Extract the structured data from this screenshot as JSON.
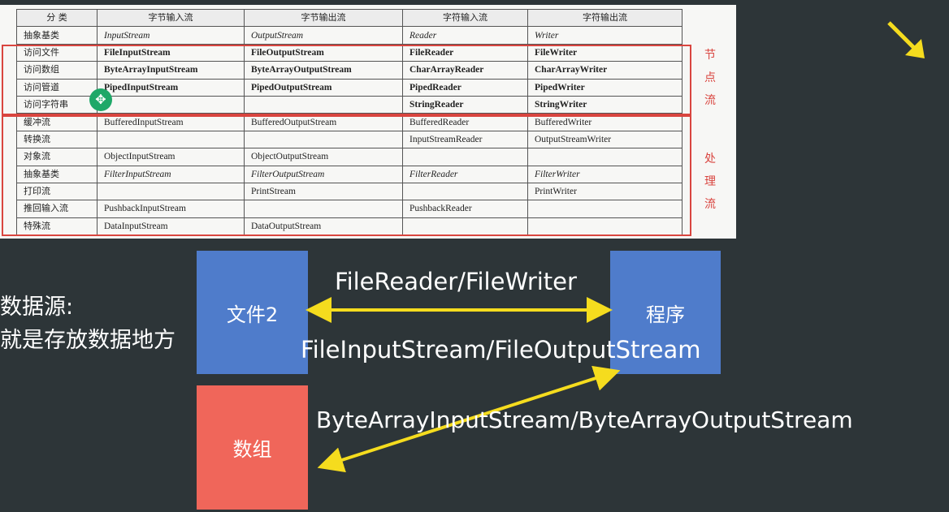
{
  "table": {
    "headers": [
      "分 类",
      "字节输入流",
      "字节输出流",
      "字符输入流",
      "字符输出流"
    ],
    "rows": [
      {
        "cat": "抽象基类",
        "cells": [
          "InputStream",
          "OutputStream",
          "Reader",
          "Writer"
        ]
      },
      {
        "cat": "访问文件",
        "cells": [
          "FileInputStream",
          "FileOutputStream",
          "FileReader",
          "FileWriter"
        ]
      },
      {
        "cat": "访问数组",
        "cells": [
          "ByteArrayInputStream",
          "ByteArrayOutputStream",
          "CharArrayReader",
          "CharArrayWriter"
        ]
      },
      {
        "cat": "访问管道",
        "cells": [
          "PipedInputStream",
          "PipedOutputStream",
          "PipedReader",
          "PipedWriter"
        ]
      },
      {
        "cat": "访问字符串",
        "cells": [
          "",
          "",
          "StringReader",
          "StringWriter"
        ]
      },
      {
        "cat": "缓冲流",
        "cells": [
          "BufferedInputStream",
          "BufferedOutputStream",
          "BufferedReader",
          "BufferedWriter"
        ]
      },
      {
        "cat": "转换流",
        "cells": [
          "",
          "",
          "InputStreamReader",
          "OutputStreamWriter"
        ]
      },
      {
        "cat": "对象流",
        "cells": [
          "ObjectInputStream",
          "ObjectOutputStream",
          "",
          ""
        ]
      },
      {
        "cat": "抽象基类",
        "cells": [
          "FilterInputStream",
          "FilterOutputStream",
          "FilterReader",
          "FilterWriter"
        ]
      },
      {
        "cat": "打印流",
        "cells": [
          "",
          "PrintStream",
          "",
          "PrintWriter"
        ]
      },
      {
        "cat": "推回输入流",
        "cells": [
          "PushbackInputStream",
          "",
          "PushbackReader",
          ""
        ]
      },
      {
        "cat": "特殊流",
        "cells": [
          "DataInputStream",
          "DataOutputStream",
          "",
          ""
        ]
      }
    ],
    "node_label": [
      "节",
      "点",
      "流"
    ],
    "process_label": [
      "处",
      "理",
      "流"
    ]
  },
  "diagram": {
    "file_box": "文件2",
    "program_box": "程序",
    "array_box": "数组",
    "reader_label": "FileReader/FileWriter",
    "filestream_label": "FileInputStream/FileOutputStream",
    "bytestream_label": "ByteArrayInputStream/ByteArrayOutputStream",
    "source_title": "数据源:",
    "source_desc": "就是存放数据地方"
  },
  "colors": {
    "background": "#2d3538",
    "box_blue": "#4f7ccb",
    "box_red": "#f0665a",
    "arrow": "#f5dc1e",
    "highlight_red": "#d9453f"
  },
  "icons": {
    "cursor": "move-cursor-icon",
    "pointer": "arrow-pointer-icon"
  }
}
